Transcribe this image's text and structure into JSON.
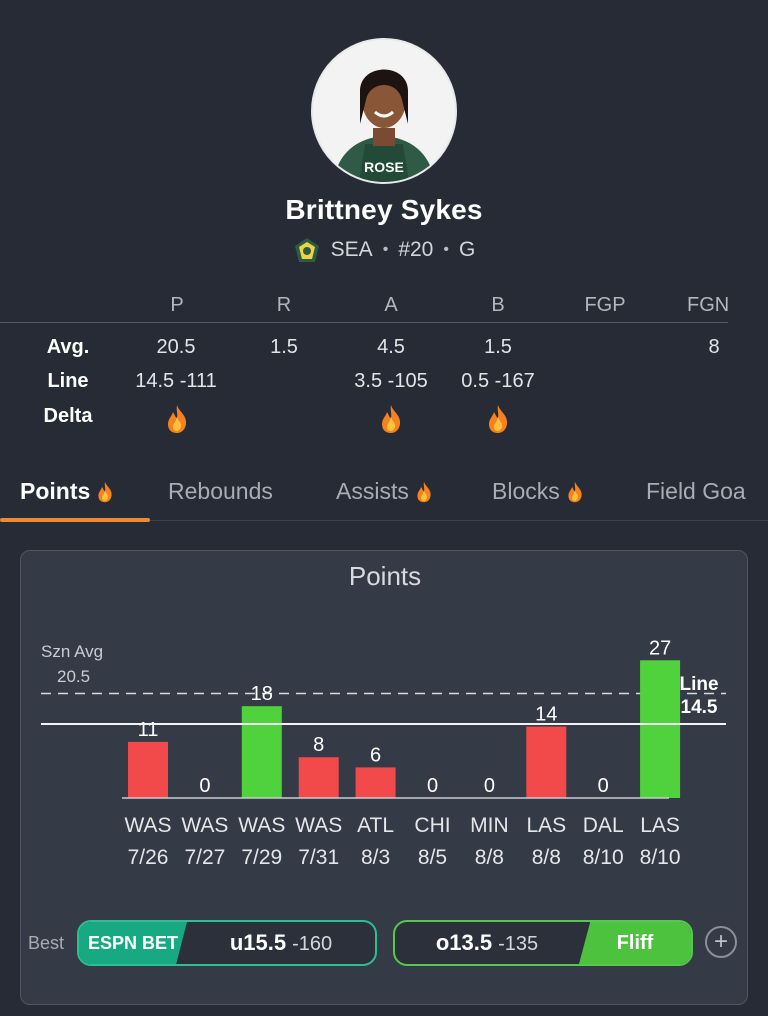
{
  "player": {
    "name": "Brittney Sykes",
    "team": "SEA",
    "number": "#20",
    "position": "G",
    "jersey_text": "ROSE"
  },
  "stats_table": {
    "columns": [
      "P",
      "R",
      "A",
      "B",
      "FGP",
      "FGN"
    ],
    "rows": {
      "avg": {
        "label": "Avg.",
        "values": [
          "20.5",
          "1.5",
          "4.5",
          "1.5",
          "",
          "8"
        ]
      },
      "line": {
        "label": "Line",
        "values": [
          "14.5 -111",
          "",
          "3.5 -105",
          "0.5 -167",
          "",
          ""
        ]
      },
      "delta": {
        "label": "Delta",
        "flames": [
          true,
          false,
          true,
          true,
          false,
          false
        ]
      }
    }
  },
  "tabs": [
    {
      "label": "Points",
      "flame": true,
      "active": true
    },
    {
      "label": "Rebounds",
      "flame": false,
      "active": false
    },
    {
      "label": "Assists",
      "flame": true,
      "active": false
    },
    {
      "label": "Blocks",
      "flame": true,
      "active": false
    },
    {
      "label": "Field Goa",
      "flame": false,
      "active": false
    }
  ],
  "chart_title": "Points",
  "chart_data": {
    "type": "bar",
    "title": "Points",
    "categories": [
      "WAS 7/26",
      "WAS 7/27",
      "WAS 7/29",
      "WAS 7/31",
      "ATL 8/3",
      "CHI 8/5",
      "MIN 8/8",
      "LAS 8/8",
      "DAL 8/10",
      "LAS 8/10"
    ],
    "opponents": [
      "WAS",
      "WAS",
      "WAS",
      "WAS",
      "ATL",
      "CHI",
      "MIN",
      "LAS",
      "DAL",
      "LAS"
    ],
    "dates": [
      "7/26",
      "7/27",
      "7/29",
      "7/31",
      "8/3",
      "8/5",
      "8/8",
      "8/8",
      "8/10",
      "8/10"
    ],
    "values": [
      11,
      0,
      18,
      8,
      6,
      0,
      0,
      14,
      0,
      27
    ],
    "season_avg_label": "Szn Avg",
    "season_avg": 20.5,
    "line_label": "Line",
    "line": 14.5,
    "colors": {
      "over": "#50d23c",
      "under": "#f24a4a"
    }
  },
  "odds": {
    "best_label": "Best",
    "under": {
      "book": "ESPN BET",
      "pick": "u15.5",
      "price": "-160"
    },
    "over": {
      "book": "Fliff",
      "pick": "o13.5",
      "price": "-135"
    },
    "add_label": "+"
  }
}
